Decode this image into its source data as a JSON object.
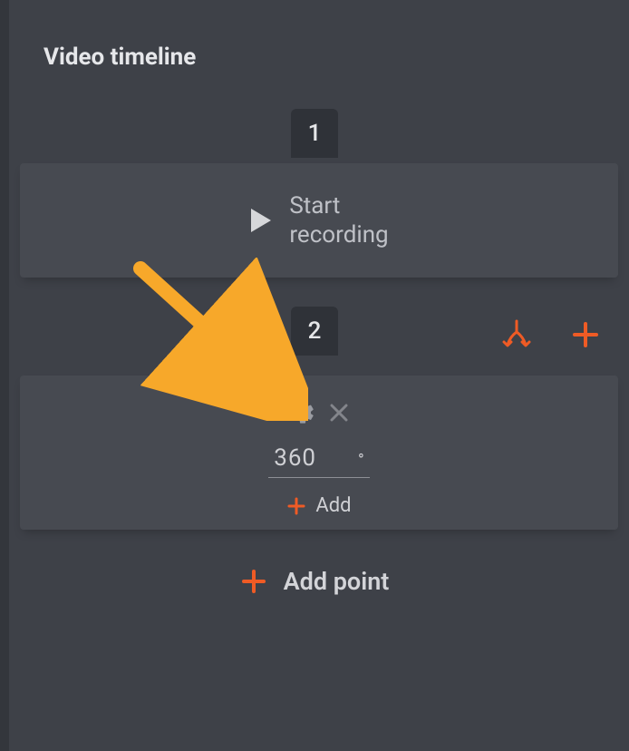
{
  "title": "Video timeline",
  "steps": {
    "one": {
      "number": "1",
      "label": "Start\nrecording"
    },
    "two": {
      "number": "2",
      "rotation_value": "360",
      "rotation_unit": "°",
      "add_label": "Add"
    }
  },
  "add_point_label": "Add point",
  "colors": {
    "accent": "#ef5b25",
    "annotation": "#f7a82a"
  }
}
